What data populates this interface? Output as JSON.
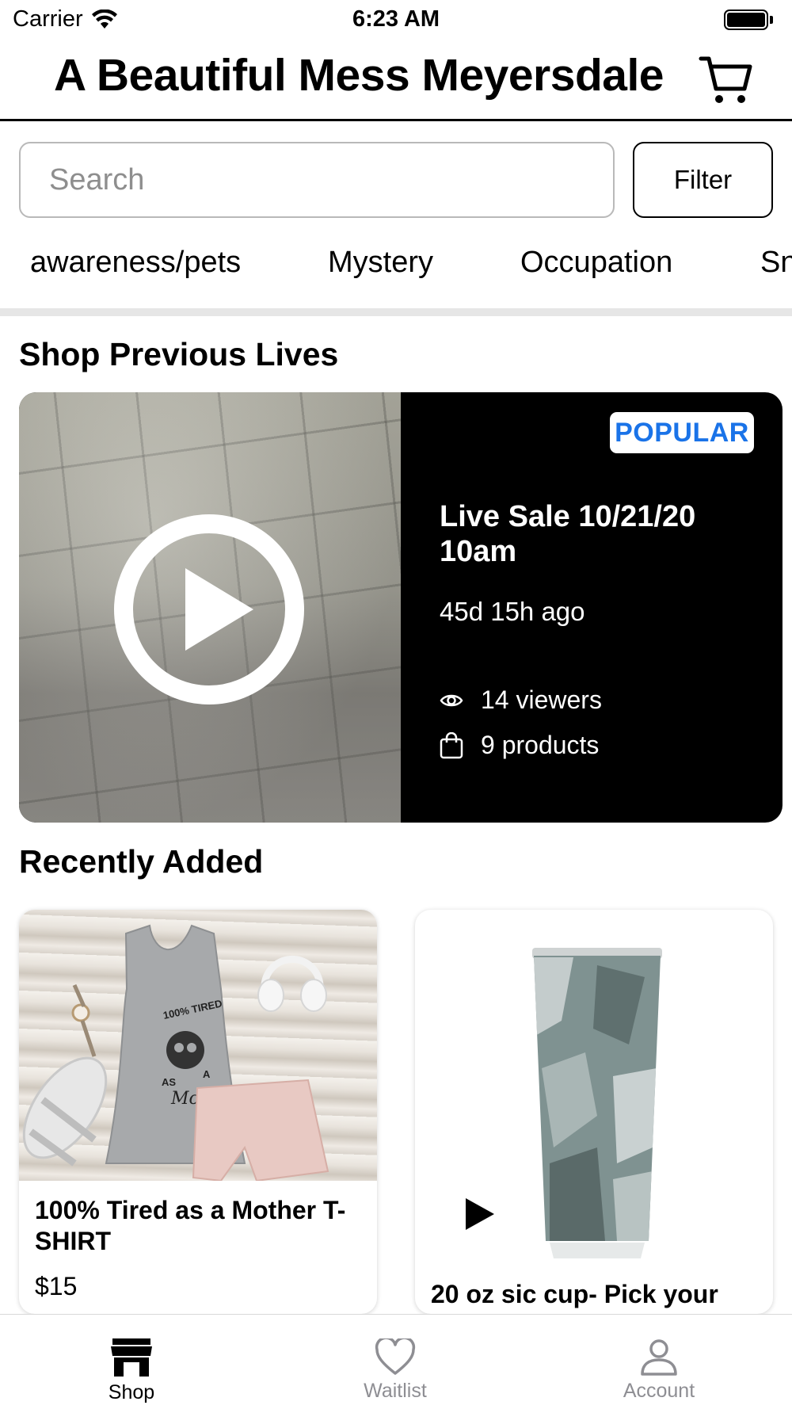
{
  "status_bar": {
    "carrier": "Carrier",
    "time": "6:23 AM"
  },
  "header": {
    "title": "A Beautiful Mess Meyersdale",
    "cart_icon": "cart-icon"
  },
  "search": {
    "placeholder": "Search",
    "filter_label": "Filter"
  },
  "categories": [
    "awareness/pets",
    "Mystery",
    "Occupation",
    "Sn"
  ],
  "previous_lives": {
    "section_title": "Shop Previous Lives",
    "card": {
      "badge": "POPULAR",
      "title": "Live Sale 10/21/20 10am",
      "ago": "45d 15h ago",
      "viewers": "14 viewers",
      "products": "9 products"
    }
  },
  "recently_added": {
    "section_title": "Recently Added",
    "items": [
      {
        "name": "100% Tired as a Mother T-SHIRT",
        "price": "$15",
        "shirt_text": [
          "100% TIRED",
          "AS",
          "A",
          "Mother"
        ]
      },
      {
        "name": "20 oz sic cup- Pick your"
      }
    ]
  },
  "tab_bar": {
    "tabs": [
      {
        "label": "Shop",
        "icon": "store-icon",
        "active": true
      },
      {
        "label": "Waitlist",
        "icon": "heart-icon",
        "active": false
      },
      {
        "label": "Account",
        "icon": "person-icon",
        "active": false
      }
    ]
  },
  "colors": {
    "accent_blue": "#1a73e8",
    "inactive_tab": "#8e8e93",
    "card_background": "#000000"
  }
}
